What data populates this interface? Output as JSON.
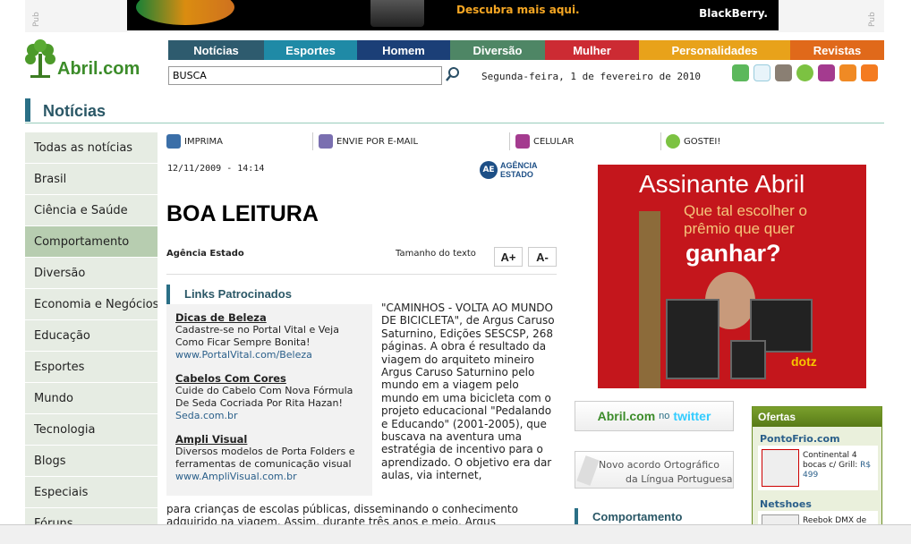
{
  "top_ad": {
    "side_label": "Pub",
    "cta": "Descubra mais aqui.",
    "brand": "BlackBerry."
  },
  "logo": {
    "brand": "Abril.com"
  },
  "nav": [
    {
      "label": "Notícias",
      "color": "#2e5b6e"
    },
    {
      "label": "Esportes",
      "color": "#1f8aa6"
    },
    {
      "label": "Homem",
      "color": "#1b3f77"
    },
    {
      "label": "Diversão",
      "color": "#4e8665"
    },
    {
      "label": "Mulher",
      "color": "#cc2b33"
    },
    {
      "label": "Personalidades",
      "color": "#e8a21a"
    },
    {
      "label": "Revistas",
      "color": "#e0691a"
    }
  ],
  "search": {
    "value": "BUSCA"
  },
  "date": "Segunda-feira, 1 de fevereiro de 2010",
  "header_icons": [
    "chat-icon",
    "star-icon",
    "contacts-icon",
    "gostei-icon",
    "mobile-icon",
    "rss-icon",
    "home-icon"
  ],
  "section": {
    "title": "Notícias"
  },
  "sidebar": [
    "Todas as notícias",
    "Brasil",
    "Ciência e Saúde",
    "Comportamento",
    "Diversão",
    "Economia e Negócios",
    "Educação",
    "Esportes",
    "Mundo",
    "Tecnologia",
    "Blogs",
    "Especiais",
    "Fóruns"
  ],
  "toolbar": {
    "print": "IMPRIMA",
    "email": "ENVIE POR E-MAIL",
    "mobile": "CELULAR",
    "like": "GOSTEI!"
  },
  "article": {
    "timestamp": "12/11/2009 - 14:14",
    "agency_logo": "AE",
    "agency_line1": "AGÊNCIA",
    "agency_line2": "ESTADO",
    "headline": "BOA LEITURA",
    "source": "Agência Estado",
    "size_label": "Tamanho do texto",
    "size_up": "A+",
    "size_down": "A-",
    "body_col": "\"CAMINHOS - VOLTA AO MUNDO DE BICICLETA\", de Argus Caruso Saturnino, Edições SESCSP, 268 páginas. A obra é resultado da viagem do arquiteto mineiro Argus Caruso Saturnino pelo mundo em a viagem pelo mundo em uma bicicleta com o projeto educacional \"Pedalando e Educando\" (2001-2005), que buscava na aventura uma estratégia de incentivo para o aprendizado. O objetivo era dar aulas, via internet,",
    "body_full": "para crianças de escolas públicas, disseminando o conhecimento adquirido na viagem. Assim, durante três anos e meio, Argus"
  },
  "sponsored": {
    "title": "Links Patrocinados",
    "ads": [
      {
        "title": "Dicas de Beleza",
        "desc": "Cadastre-se no Portal Vital e Veja Como Ficar Sempre Bonita!",
        "url": "www.PortalVital.com/Beleza"
      },
      {
        "title": "Cabelos Com Cores",
        "desc": "Cuide do Cabelo Com Nova Fórmula De Seda Cocriada Por Rita Hazan!",
        "url": "Seda.com.br"
      },
      {
        "title": "Ampli Visual",
        "desc": "Diversos modelos de Porta Folders e ferramentas de comunicação visual",
        "url": "www.AmpliVisual.com.br"
      }
    ]
  },
  "big_ad": {
    "line1": "Assinante Abril",
    "line2": "Que tal escolher o",
    "line3": "prêmio que quer",
    "line4": "ganhar?",
    "brand": "dotz"
  },
  "twitter_box": {
    "a": "Abril.com",
    "no": "no",
    "tw": "twitter"
  },
  "acordo_box": {
    "line1": "Novo acordo Ortográfico",
    "line2": "da Língua Portuguesa"
  },
  "comportamento": {
    "title": "Comportamento"
  },
  "ofertas": {
    "title": "Ofertas",
    "store1": "PontoFrio.com",
    "product1": "Continental 4 bocas c/ Grill:",
    "price1": "R$ 499",
    "store2": "Netshoes",
    "product2": "Reebok DMX de"
  }
}
